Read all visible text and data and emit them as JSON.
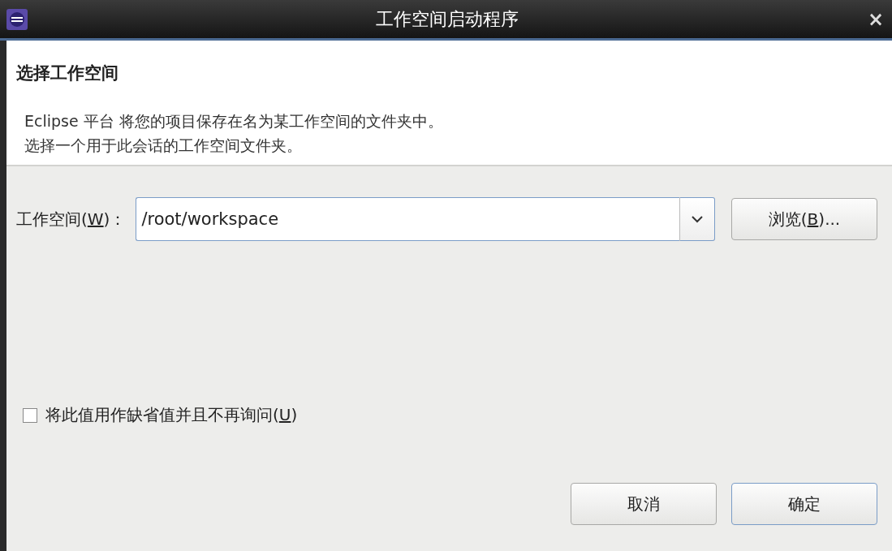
{
  "window": {
    "title": "工作空间启动程序",
    "close": "×"
  },
  "header": {
    "title": "选择工作空间",
    "description": [
      "Eclipse 平台 将您的项目保存在名为某工作空间的文件夹中。",
      "选择一个用于此会话的工作空间文件夹。"
    ]
  },
  "workspace": {
    "label": {
      "before": "工作空间(",
      "mnemonic": "W",
      "after": ")："
    },
    "value": "/root/workspace",
    "browse": {
      "before": "浏览(",
      "mnemonic": "B",
      "after": ")..."
    }
  },
  "remember": {
    "label": {
      "before": "将此值用作缺省值并且不再询问(",
      "mnemonic": "U",
      "after": ")"
    },
    "checked": false
  },
  "buttons": [
    {
      "label": "取消",
      "default": false
    },
    {
      "label": "确定",
      "default": true
    }
  ]
}
